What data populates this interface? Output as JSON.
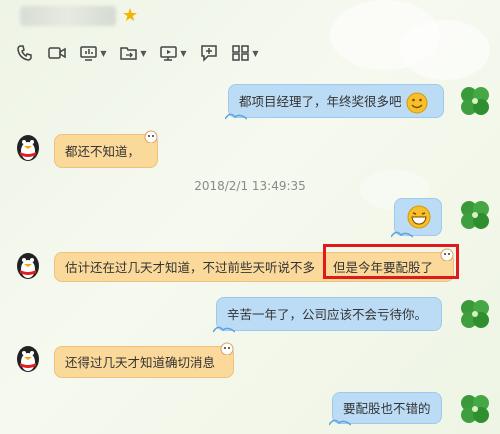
{
  "header": {
    "star_icon": "★"
  },
  "toolbar": {
    "items": [
      "phone-icon",
      "video-icon",
      "screen-share-icon",
      "file-transfer-icon",
      "remote-desktop-icon",
      "new-chat-icon",
      "apps-grid-icon"
    ]
  },
  "messages": [
    {
      "side": "right",
      "text": "都项目经理了，年终奖很多吧"
    },
    {
      "side": "left",
      "text": "都还不知道，"
    },
    {
      "side": "right",
      "text": ""
    },
    {
      "side": "left",
      "text": "估计还在过几天才知道，不过前些天听说不多",
      "highlight": "但是今年要配股了"
    },
    {
      "side": "right",
      "text": "辛苦一年了，公司应该不会亏待你。"
    },
    {
      "side": "left",
      "text": "还得过几天才知道确切消息"
    },
    {
      "side": "right",
      "text": "要配股也不错的"
    }
  ],
  "timestamp": "2018/2/1 13:49:35",
  "colors": {
    "left_bubble": "#fbd99a",
    "right_bubble": "#bcdcf6",
    "highlight": "#e0191a"
  }
}
